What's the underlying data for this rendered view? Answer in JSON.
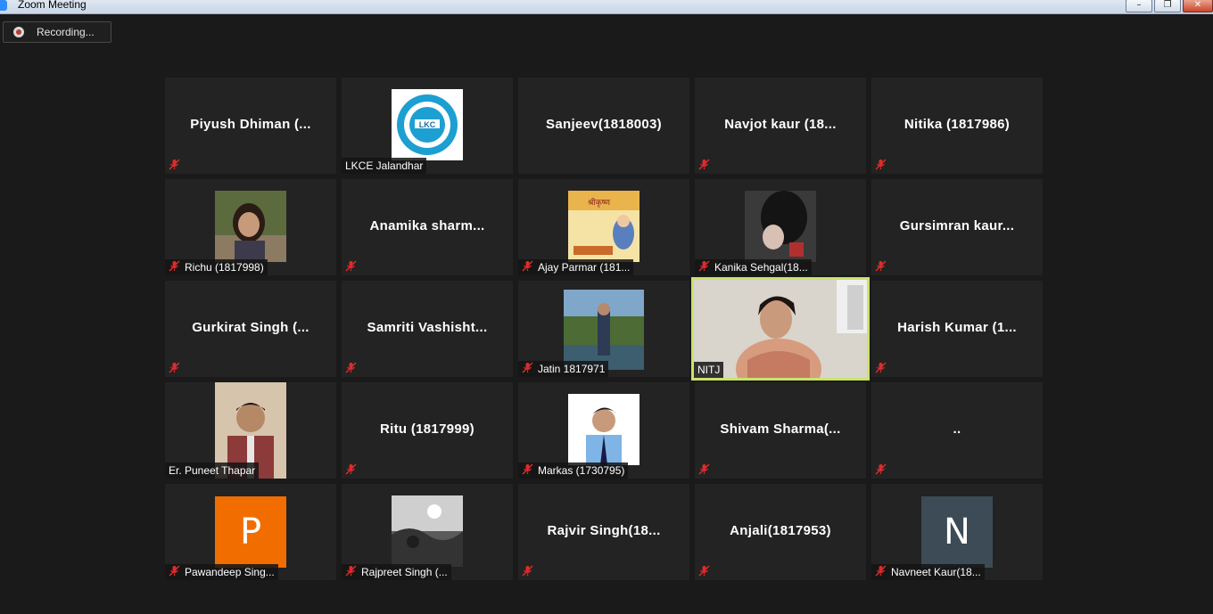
{
  "window": {
    "title": "Zoom Meeting",
    "min_glyph": "–",
    "max_glyph": "❐",
    "close_glyph": "✕"
  },
  "recording": {
    "label": "Recording..."
  },
  "colors": {
    "active_speaker_border": "#c9e36c",
    "mute_red": "#e02b2b",
    "tile_bg": "#232323",
    "avatar_orange": "#f26d00",
    "avatar_slate": "#3c4b55"
  },
  "tiles": [
    {
      "name": "Piyush Dhiman (...",
      "mode": "name",
      "muted": true
    },
    {
      "name": "LKCE Jalandhar",
      "mode": "pic",
      "muted": false,
      "pic": "lkc-logo"
    },
    {
      "name": "Sanjeev(1818003)",
      "mode": "name",
      "muted": false
    },
    {
      "name": "Navjot kaur (18...",
      "mode": "name",
      "muted": true
    },
    {
      "name": "Nitika (1817986)",
      "mode": "name",
      "muted": true
    },
    {
      "name": "Richu (1817998)",
      "mode": "pic",
      "muted": true,
      "pic": "girl-photo"
    },
    {
      "name": "Anamika sharm...",
      "mode": "name",
      "muted": true
    },
    {
      "name": "Ajay Parmar (181...",
      "mode": "pic",
      "muted": true,
      "pic": "janmashtami-card"
    },
    {
      "name": "Kanika Sehgal(18...",
      "mode": "pic",
      "muted": true,
      "pic": "dark-photo"
    },
    {
      "name": "Gursimran kaur...",
      "mode": "name",
      "muted": true
    },
    {
      "name": "Gurkirat Singh (...",
      "mode": "name",
      "muted": true
    },
    {
      "name": "Samriti Vashisht...",
      "mode": "name",
      "muted": true
    },
    {
      "name": "Jatin 1817971",
      "mode": "pic",
      "muted": true,
      "pic": "garden-photo"
    },
    {
      "name": "NITJ",
      "mode": "video",
      "muted": false,
      "active": true
    },
    {
      "name": "Harish Kumar (1...",
      "mode": "name",
      "muted": true
    },
    {
      "name": "Er. Puneet Thapar",
      "mode": "pic",
      "muted": false,
      "pic": "man-photo"
    },
    {
      "name": "Ritu (1817999)",
      "mode": "name",
      "muted": true
    },
    {
      "name": "Markas (1730795)",
      "mode": "pic",
      "muted": true,
      "pic": "boy-photo"
    },
    {
      "name": "Shivam Sharma(...",
      "mode": "name",
      "muted": true
    },
    {
      "name": "..",
      "mode": "name",
      "muted": true
    },
    {
      "name": "Pawandeep Sing...",
      "mode": "avatar",
      "muted": true,
      "letter": "P",
      "color": "#f26d00"
    },
    {
      "name": "Rajpreet Singh (...",
      "mode": "pic",
      "muted": true,
      "pic": "bw-photo"
    },
    {
      "name": "Rajvir Singh(18...",
      "mode": "name",
      "muted": true
    },
    {
      "name": "Anjali(1817953)",
      "mode": "name",
      "muted": true
    },
    {
      "name": "Navneet Kaur(18...",
      "mode": "avatar",
      "muted": true,
      "letter": "N",
      "color": "#3c4b55"
    }
  ]
}
